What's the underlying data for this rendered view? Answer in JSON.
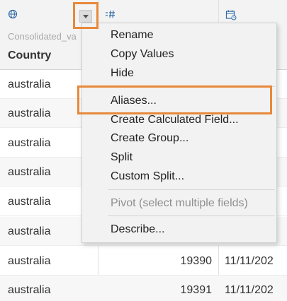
{
  "column_header": {
    "source_name": "Consolidated_va",
    "field_name": "Country",
    "type_icons": [
      "globe-icon",
      "number-icon",
      "calendar-icon"
    ]
  },
  "rows": [
    {
      "country": "australia",
      "number": "",
      "date": ""
    },
    {
      "country": "australia",
      "number": "",
      "date": ""
    },
    {
      "country": "australia",
      "number": "",
      "date": ""
    },
    {
      "country": "australia",
      "number": "",
      "date": ""
    },
    {
      "country": "australia",
      "number": "",
      "date": ""
    },
    {
      "country": "australia",
      "number": "",
      "date": ""
    },
    {
      "country": "australia",
      "number": "19390",
      "date": "11/11/202"
    },
    {
      "country": "australia",
      "number": "19391",
      "date": "11/11/202"
    }
  ],
  "context_menu": {
    "items": [
      {
        "label": "Rename",
        "enabled": true
      },
      {
        "label": "Copy Values",
        "enabled": true
      },
      {
        "label": "Hide",
        "enabled": true
      },
      {
        "label": "Aliases...",
        "enabled": true
      },
      {
        "label": "Create Calculated Field...",
        "enabled": true
      },
      {
        "label": "Create Group...",
        "enabled": true
      },
      {
        "label": "Split",
        "enabled": true
      },
      {
        "label": "Custom Split...",
        "enabled": true
      },
      {
        "label": "Pivot (select multiple fields)",
        "enabled": false
      },
      {
        "label": "Describe...",
        "enabled": true
      }
    ]
  },
  "colors": {
    "highlight": "#e8883a",
    "icon_blue": "#2f6aa6"
  }
}
